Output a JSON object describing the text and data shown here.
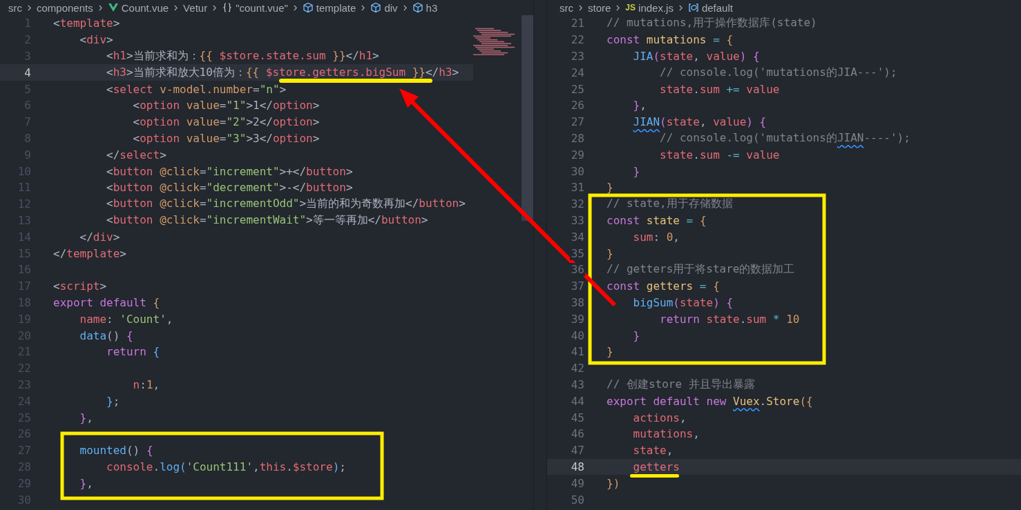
{
  "panes": [
    {
      "breadcrumbs": [
        {
          "label": "src"
        },
        {
          "label": "components"
        },
        {
          "label": "Count.vue",
          "kind": "vue"
        },
        {
          "label": "Vetur"
        },
        {
          "label": "\"count.vue\"",
          "kind": "braces"
        },
        {
          "label": "template",
          "kind": "cube"
        },
        {
          "label": "div",
          "kind": "cube"
        },
        {
          "label": "h3",
          "kind": "cube"
        }
      ],
      "lines": [
        {
          "number": "1",
          "current": false,
          "tokens": [
            {
              "text": "<",
              "kind": "punct"
            },
            {
              "text": "template",
              "kind": "tag"
            },
            {
              "text": ">",
              "kind": "punct"
            }
          ]
        },
        {
          "number": "2",
          "current": false,
          "tokens": [
            {
              "text": "    <",
              "kind": "punct"
            },
            {
              "text": "div",
              "kind": "tag"
            },
            {
              "text": ">",
              "kind": "punct"
            }
          ]
        },
        {
          "number": "3",
          "current": false,
          "tokens": [
            {
              "text": "        <",
              "kind": "punct"
            },
            {
              "text": "h1",
              "kind": "tag"
            },
            {
              "text": ">当前求和为：",
              "kind": "punct"
            },
            {
              "text": "{{",
              "kind": "brace"
            },
            {
              "text": " $store.state.sum ",
              "kind": "var"
            },
            {
              "text": "}}",
              "kind": "brace"
            },
            {
              "text": "</",
              "kind": "punct"
            },
            {
              "text": "h1",
              "kind": "tag"
            },
            {
              "text": ">",
              "kind": "punct"
            }
          ]
        },
        {
          "number": "4",
          "current": true,
          "tokens": [
            {
              "text": "        <",
              "kind": "punct"
            },
            {
              "text": "h3",
              "kind": "tag"
            },
            {
              "text": ">当前求和放大10倍为：",
              "kind": "punct"
            },
            {
              "text": "{{",
              "kind": "brace"
            },
            {
              "text": " $store.getters.bigSum ",
              "kind": "var"
            },
            {
              "text": "}}",
              "kind": "brace"
            },
            {
              "text": "</",
              "kind": "punct"
            },
            {
              "text": "h3",
              "kind": "tag"
            },
            {
              "text": ">",
              "kind": "punct"
            }
          ]
        },
        {
          "number": "5",
          "current": false,
          "tokens": [
            {
              "text": "        <",
              "kind": "punct"
            },
            {
              "text": "select",
              "kind": "tag"
            },
            {
              "text": " v-model.number",
              "kind": "attr"
            },
            {
              "text": "=",
              "kind": "punct"
            },
            {
              "text": "\"n\"",
              "kind": "str"
            },
            {
              "text": ">",
              "kind": "punct"
            }
          ]
        },
        {
          "number": "6",
          "current": false,
          "tokens": [
            {
              "text": "            <",
              "kind": "punct"
            },
            {
              "text": "option",
              "kind": "tag"
            },
            {
              "text": " value",
              "kind": "attr"
            },
            {
              "text": "=",
              "kind": "punct"
            },
            {
              "text": "\"1\"",
              "kind": "str"
            },
            {
              "text": ">1</",
              "kind": "punct"
            },
            {
              "text": "option",
              "kind": "tag"
            },
            {
              "text": ">",
              "kind": "punct"
            }
          ]
        },
        {
          "number": "7",
          "current": false,
          "tokens": [
            {
              "text": "            <",
              "kind": "punct"
            },
            {
              "text": "option",
              "kind": "tag"
            },
            {
              "text": " value",
              "kind": "attr"
            },
            {
              "text": "=",
              "kind": "punct"
            },
            {
              "text": "\"2\"",
              "kind": "str"
            },
            {
              "text": ">2</",
              "kind": "punct"
            },
            {
              "text": "option",
              "kind": "tag"
            },
            {
              "text": ">",
              "kind": "punct"
            }
          ]
        },
        {
          "number": "8",
          "current": false,
          "tokens": [
            {
              "text": "            <",
              "kind": "punct"
            },
            {
              "text": "option",
              "kind": "tag"
            },
            {
              "text": " value",
              "kind": "attr"
            },
            {
              "text": "=",
              "kind": "punct"
            },
            {
              "text": "\"3\"",
              "kind": "str"
            },
            {
              "text": ">3</",
              "kind": "punct"
            },
            {
              "text": "option",
              "kind": "tag"
            },
            {
              "text": ">",
              "kind": "punct"
            }
          ]
        },
        {
          "number": "9",
          "current": false,
          "tokens": [
            {
              "text": "        </",
              "kind": "punct"
            },
            {
              "text": "select",
              "kind": "tag"
            },
            {
              "text": ">",
              "kind": "punct"
            }
          ]
        },
        {
          "number": "10",
          "current": false,
          "tokens": [
            {
              "text": "        <",
              "kind": "punct"
            },
            {
              "text": "button",
              "kind": "tag"
            },
            {
              "text": " @click",
              "kind": "attr"
            },
            {
              "text": "=",
              "kind": "punct"
            },
            {
              "text": "\"increment\"",
              "kind": "str"
            },
            {
              "text": ">+</",
              "kind": "punct"
            },
            {
              "text": "button",
              "kind": "tag"
            },
            {
              "text": ">",
              "kind": "punct"
            }
          ]
        },
        {
          "number": "11",
          "current": false,
          "tokens": [
            {
              "text": "        <",
              "kind": "punct"
            },
            {
              "text": "button",
              "kind": "tag"
            },
            {
              "text": " @click",
              "kind": "attr"
            },
            {
              "text": "=",
              "kind": "punct"
            },
            {
              "text": "\"decrement\"",
              "kind": "str"
            },
            {
              "text": ">-</",
              "kind": "punct"
            },
            {
              "text": "button",
              "kind": "tag"
            },
            {
              "text": ">",
              "kind": "punct"
            }
          ]
        },
        {
          "number": "12",
          "current": false,
          "tokens": [
            {
              "text": "        <",
              "kind": "punct"
            },
            {
              "text": "button",
              "kind": "tag"
            },
            {
              "text": " @click",
              "kind": "attr"
            },
            {
              "text": "=",
              "kind": "punct"
            },
            {
              "text": "\"incrementOdd\"",
              "kind": "str"
            },
            {
              "text": ">当前的和为奇数再加</",
              "kind": "punct"
            },
            {
              "text": "button",
              "kind": "tag"
            },
            {
              "text": ">",
              "kind": "punct"
            }
          ]
        },
        {
          "number": "13",
          "current": false,
          "tokens": [
            {
              "text": "        <",
              "kind": "punct"
            },
            {
              "text": "button",
              "kind": "tag"
            },
            {
              "text": " @click",
              "kind": "attr"
            },
            {
              "text": "=",
              "kind": "punct"
            },
            {
              "text": "\"incrementWait\"",
              "kind": "str"
            },
            {
              "text": ">等一等再加</",
              "kind": "punct"
            },
            {
              "text": "button",
              "kind": "tag"
            },
            {
              "text": ">",
              "kind": "punct"
            }
          ]
        },
        {
          "number": "14",
          "current": false,
          "tokens": [
            {
              "text": "    </",
              "kind": "punct"
            },
            {
              "text": "div",
              "kind": "tag"
            },
            {
              "text": ">",
              "kind": "punct"
            }
          ]
        },
        {
          "number": "15",
          "current": false,
          "tokens": [
            {
              "text": "</",
              "kind": "punct"
            },
            {
              "text": "template",
              "kind": "tag"
            },
            {
              "text": ">",
              "kind": "punct"
            }
          ]
        },
        {
          "number": "16",
          "current": false
        },
        {
          "number": "17",
          "current": false,
          "tokens": [
            {
              "text": "<",
              "kind": "punct"
            },
            {
              "text": "script",
              "kind": "tag"
            },
            {
              "text": ">",
              "kind": "punct"
            }
          ]
        },
        {
          "number": "18",
          "current": false,
          "tokens": [
            {
              "text": "export default ",
              "kind": "kw"
            },
            {
              "text": "{",
              "kind": "brace"
            }
          ]
        },
        {
          "number": "19",
          "current": false,
          "tokens": [
            {
              "text": "    name",
              "kind": "var"
            },
            {
              "text": ": ",
              "kind": "punct"
            },
            {
              "text": "'Count'",
              "kind": "str"
            },
            {
              "text": ",",
              "kind": "punct"
            }
          ]
        },
        {
          "number": "20",
          "current": false,
          "tokens": [
            {
              "text": "    data",
              "kind": "fn"
            },
            {
              "text": "() ",
              "kind": "punct"
            },
            {
              "text": "{",
              "kind": "brace2"
            }
          ]
        },
        {
          "number": "21",
          "current": false,
          "tokens": [
            {
              "text": "        return ",
              "kind": "kw"
            },
            {
              "text": "{",
              "kind": "brace3"
            }
          ]
        },
        {
          "number": "22",
          "current": false
        },
        {
          "number": "23",
          "current": false,
          "tokens": [
            {
              "text": "            n",
              "kind": "var"
            },
            {
              "text": ":",
              "kind": "punct"
            },
            {
              "text": "1",
              "kind": "num"
            },
            {
              "text": ",",
              "kind": "punct"
            }
          ]
        },
        {
          "number": "24",
          "current": false,
          "tokens": [
            {
              "text": "        }",
              "kind": "brace3"
            },
            {
              "text": ";",
              "kind": "punct"
            }
          ]
        },
        {
          "number": "25",
          "current": false,
          "tokens": [
            {
              "text": "    }",
              "kind": "brace2"
            },
            {
              "text": ",",
              "kind": "punct"
            }
          ]
        },
        {
          "number": "26",
          "current": false
        },
        {
          "number": "27",
          "current": false,
          "tokens": [
            {
              "text": "    mounted",
              "kind": "fn"
            },
            {
              "text": "() ",
              "kind": "punct"
            },
            {
              "text": "{",
              "kind": "brace2"
            }
          ]
        },
        {
          "number": "28",
          "current": false,
          "tokens": [
            {
              "text": "        console",
              "kind": "var"
            },
            {
              "text": ".",
              "kind": "punct"
            },
            {
              "text": "log",
              "kind": "fn"
            },
            {
              "text": "(",
              "kind": "brace3"
            },
            {
              "text": "'Count111'",
              "kind": "str"
            },
            {
              "text": ",",
              "kind": "punct"
            },
            {
              "text": "this",
              "kind": "var"
            },
            {
              "text": ".",
              "kind": "punct"
            },
            {
              "text": "$store",
              "kind": "var"
            },
            {
              "text": ")",
              "kind": "brace3"
            },
            {
              "text": ";",
              "kind": "punct"
            }
          ]
        },
        {
          "number": "29",
          "current": false,
          "tokens": [
            {
              "text": "    }",
              "kind": "brace2"
            },
            {
              "text": ",",
              "kind": "punct"
            }
          ]
        },
        {
          "number": "30",
          "current": false
        }
      ]
    },
    {
      "breadcrumbs": [
        {
          "label": "src"
        },
        {
          "label": "store"
        },
        {
          "label": "index.js",
          "badge": "JS"
        },
        {
          "label": "default",
          "kind": "variable"
        }
      ],
      "lines": [
        {
          "number": "21",
          "current": false,
          "tokens": [
            {
              "text": "// mutations,用于操作数据库(state)",
              "kind": "comment"
            }
          ]
        },
        {
          "number": "22",
          "current": false,
          "tokens": [
            {
              "text": "const ",
              "kind": "kw"
            },
            {
              "text": "mutations",
              "kind": "const"
            },
            {
              "text": " = ",
              "kind": "op"
            },
            {
              "text": "{",
              "kind": "brace"
            }
          ]
        },
        {
          "number": "23",
          "current": false,
          "tokens": [
            {
              "text": "    JIA",
              "kind": "fn"
            },
            {
              "text": "(",
              "kind": "brace2"
            },
            {
              "text": "state",
              "kind": "var"
            },
            {
              "text": ", ",
              "kind": "punct"
            },
            {
              "text": "value",
              "kind": "var"
            },
            {
              "text": ") {",
              "kind": "brace2"
            }
          ]
        },
        {
          "number": "24",
          "current": false,
          "tokens": [
            {
              "text": "        // console.log('mutations的JIA---');",
              "kind": "comment"
            }
          ]
        },
        {
          "number": "25",
          "current": false,
          "tokens": [
            {
              "text": "        state",
              "kind": "var"
            },
            {
              "text": ".",
              "kind": "punct"
            },
            {
              "text": "sum",
              "kind": "var"
            },
            {
              "text": " += ",
              "kind": "op"
            },
            {
              "text": "value",
              "kind": "var"
            }
          ]
        },
        {
          "number": "26",
          "current": false,
          "tokens": [
            {
              "text": "    }",
              "kind": "brace2"
            },
            {
              "text": ",",
              "kind": "punct"
            }
          ]
        },
        {
          "number": "27",
          "current": false,
          "tokens": [
            {
              "text": "    JIAN",
              "kind": "fn",
              "squiggle": true
            },
            {
              "text": "(",
              "kind": "brace2"
            },
            {
              "text": "state",
              "kind": "var"
            },
            {
              "text": ", ",
              "kind": "punct"
            },
            {
              "text": "value",
              "kind": "var"
            },
            {
              "text": ") {",
              "kind": "brace2"
            }
          ]
        },
        {
          "number": "28",
          "current": false,
          "tokens": [
            {
              "text": "        // console.log('mutations的",
              "kind": "comment"
            },
            {
              "text": "JIAN",
              "kind": "comment",
              "squiggle": true
            },
            {
              "text": "----');",
              "kind": "comment"
            }
          ]
        },
        {
          "number": "29",
          "current": false,
          "tokens": [
            {
              "text": "        state",
              "kind": "var"
            },
            {
              "text": ".",
              "kind": "punct"
            },
            {
              "text": "sum",
              "kind": "var"
            },
            {
              "text": " -= ",
              "kind": "op"
            },
            {
              "text": "value",
              "kind": "var"
            }
          ]
        },
        {
          "number": "30",
          "current": false,
          "tokens": [
            {
              "text": "    }",
              "kind": "brace2"
            }
          ]
        },
        {
          "number": "31",
          "current": false,
          "tokens": [
            {
              "text": "}",
              "kind": "brace"
            }
          ]
        },
        {
          "number": "32",
          "current": false,
          "tokens": [
            {
              "text": "// state,用于存储数据",
              "kind": "comment"
            }
          ]
        },
        {
          "number": "33",
          "current": false,
          "tokens": [
            {
              "text": "const ",
              "kind": "kw"
            },
            {
              "text": "state",
              "kind": "const"
            },
            {
              "text": " = ",
              "kind": "op"
            },
            {
              "text": "{",
              "kind": "brace"
            }
          ]
        },
        {
          "number": "34",
          "current": false,
          "tokens": [
            {
              "text": "    sum",
              "kind": "var"
            },
            {
              "text": ": ",
              "kind": "punct"
            },
            {
              "text": "0",
              "kind": "num"
            },
            {
              "text": ",",
              "kind": "punct"
            }
          ]
        },
        {
          "number": "35",
          "current": false,
          "tokens": [
            {
              "text": "}",
              "kind": "brace"
            }
          ]
        },
        {
          "number": "36",
          "current": false,
          "tokens": [
            {
              "text": "// getters用于将stare的数据加工",
              "kind": "comment"
            }
          ]
        },
        {
          "number": "37",
          "current": false,
          "tokens": [
            {
              "text": "const ",
              "kind": "kw"
            },
            {
              "text": "getters",
              "kind": "const"
            },
            {
              "text": " = ",
              "kind": "op"
            },
            {
              "text": "{",
              "kind": "brace"
            }
          ]
        },
        {
          "number": "38",
          "current": false,
          "tokens": [
            {
              "text": "    bigSum",
              "kind": "fn"
            },
            {
              "text": "(",
              "kind": "brace2"
            },
            {
              "text": "state",
              "kind": "var"
            },
            {
              "text": ") {",
              "kind": "brace2"
            }
          ]
        },
        {
          "number": "39",
          "current": false,
          "tokens": [
            {
              "text": "        return ",
              "kind": "kw"
            },
            {
              "text": "state",
              "kind": "var"
            },
            {
              "text": ".",
              "kind": "punct"
            },
            {
              "text": "sum",
              "kind": "var"
            },
            {
              "text": " * ",
              "kind": "op"
            },
            {
              "text": "10",
              "kind": "num"
            }
          ]
        },
        {
          "number": "40",
          "current": false,
          "tokens": [
            {
              "text": "    }",
              "kind": "brace2"
            }
          ]
        },
        {
          "number": "41",
          "current": false,
          "tokens": [
            {
              "text": "}",
              "kind": "brace"
            }
          ]
        },
        {
          "number": "42",
          "current": false
        },
        {
          "number": "43",
          "current": false,
          "tokens": [
            {
              "text": "// 创建store 并且导出暴露",
              "kind": "comment"
            }
          ]
        },
        {
          "number": "44",
          "current": false,
          "tokens": [
            {
              "text": "export default new ",
              "kind": "kw"
            },
            {
              "text": "Vuex",
              "kind": "const",
              "squiggle": true
            },
            {
              "text": ".",
              "kind": "punct"
            },
            {
              "text": "Store",
              "kind": "const"
            },
            {
              "text": "({",
              "kind": "brace"
            }
          ]
        },
        {
          "number": "45",
          "current": false,
          "tokens": [
            {
              "text": "    actions",
              "kind": "var"
            },
            {
              "text": ",",
              "kind": "punct"
            }
          ]
        },
        {
          "number": "46",
          "current": false,
          "tokens": [
            {
              "text": "    mutations",
              "kind": "var"
            },
            {
              "text": ",",
              "kind": "punct"
            }
          ]
        },
        {
          "number": "47",
          "current": false,
          "tokens": [
            {
              "text": "    state",
              "kind": "var"
            },
            {
              "text": ",",
              "kind": "punct"
            }
          ]
        },
        {
          "number": "48",
          "current": true,
          "tokens": [
            {
              "text": "    getters",
              "kind": "var"
            }
          ]
        },
        {
          "number": "49",
          "current": false,
          "tokens": [
            {
              "text": "})",
              "kind": "brace"
            }
          ]
        },
        {
          "number": "50",
          "current": false
        }
      ]
    }
  ]
}
